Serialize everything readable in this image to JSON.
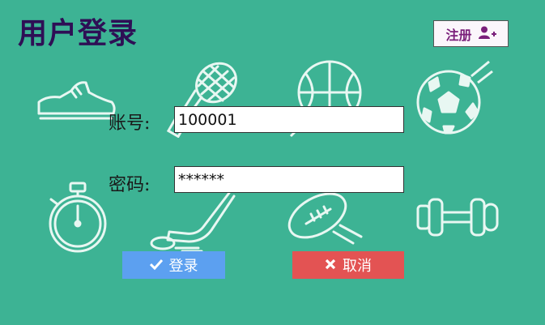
{
  "header": {
    "title": "用户登录",
    "register_label": "注册",
    "register_icon": "add-user-icon"
  },
  "form": {
    "account_label": "账号:",
    "account_value": "100001",
    "password_label": "密码:",
    "password_value": "******"
  },
  "actions": {
    "login_label": "登录",
    "login_icon": "check-icon",
    "cancel_label": "取消",
    "cancel_icon": "close-icon"
  },
  "colors": {
    "background": "#3db394",
    "title": "#2e0f55",
    "login": "#5ca0f0",
    "cancel": "#e35353"
  },
  "decorations": [
    "sneaker-icon",
    "tennis-racket-icon",
    "basketball-icon",
    "soccer-ball-icon",
    "stopwatch-icon",
    "hockey-stick-icon",
    "football-icon",
    "dumbbell-icon"
  ]
}
